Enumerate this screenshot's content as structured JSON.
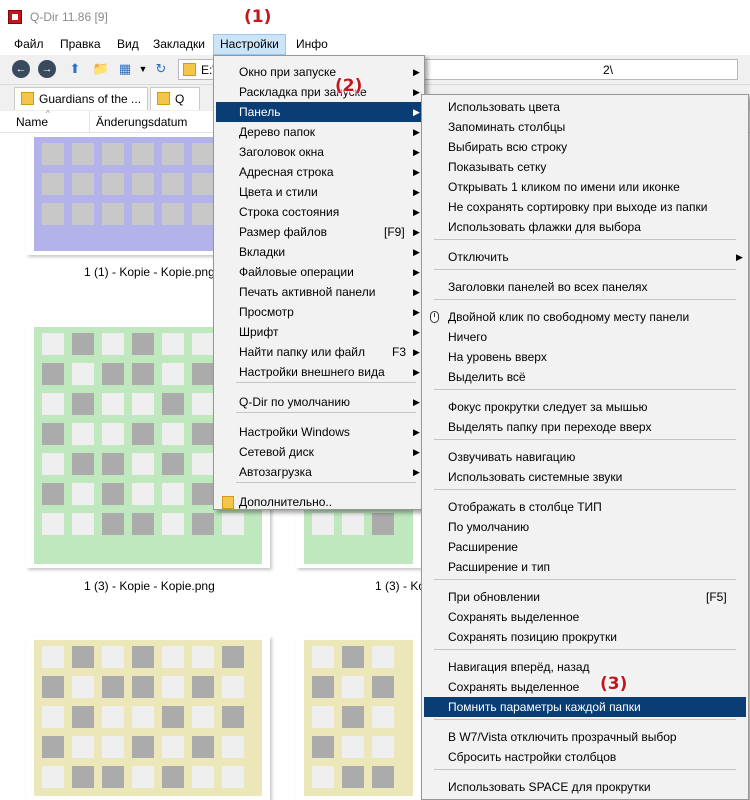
{
  "window": {
    "title": "Q-Dir 11.86 [9]"
  },
  "menubar": {
    "items": [
      {
        "label": "Файл"
      },
      {
        "label": "Правка"
      },
      {
        "label": "Вид"
      },
      {
        "label": "Закладки"
      },
      {
        "label": "Настройки",
        "active": true
      },
      {
        "label": "Инфо"
      }
    ]
  },
  "toolbar": {
    "back_icon": "arrow-left-icon",
    "forward_icon": "arrow-right-icon",
    "path_prefix": "E:\\",
    "path_suffix": "2\\"
  },
  "tabs": [
    {
      "label": "Guardians of the ..."
    },
    {
      "label": "Q"
    }
  ],
  "columns": {
    "name": "Name",
    "date": "Änderungsdatum"
  },
  "files": [
    {
      "name": "1 (1) - Kopie - Kopie.png",
      "color": "#b3b3ea"
    },
    {
      "name": "1 (3) - Kopie - Kopie.png",
      "color": "#bfe8bf"
    },
    {
      "name": "1 (3) - Ko",
      "color": "#bfe8bf"
    },
    {
      "name": "",
      "color": "#ece7b8"
    },
    {
      "name": "",
      "color": "#ece7b8"
    }
  ],
  "settings_menu": {
    "items": [
      {
        "label": "Окно при запуске",
        "submenu": true
      },
      {
        "label": "Раскладка при запуске",
        "submenu": true
      },
      {
        "label": "Панель",
        "submenu": true,
        "highlight": true
      },
      {
        "label": "Дерево папок",
        "submenu": true
      },
      {
        "label": "Заголовок окна",
        "submenu": true
      },
      {
        "label": "Адресная строка",
        "submenu": true
      },
      {
        "label": "Цвета и стили",
        "submenu": true
      },
      {
        "label": "Строка состояния",
        "submenu": true
      },
      {
        "label": "Размер файлов",
        "shortcut": "[F9]",
        "submenu": true
      },
      {
        "label": "Вкладки",
        "submenu": true
      },
      {
        "label": "Файловые операции",
        "submenu": true
      },
      {
        "label": "Печать активной панели",
        "submenu": true
      },
      {
        "label": "Просмотр",
        "submenu": true
      },
      {
        "label": "Шрифт",
        "submenu": true
      },
      {
        "label": "Найти папку или файл",
        "shortcut": "F3",
        "submenu": true
      },
      {
        "label": "Настройки внешнего вида",
        "submenu": true
      },
      {
        "label": "Q-Dir по умолчанию",
        "submenu": true
      },
      {
        "label": "Настройки Windows",
        "submenu": true
      },
      {
        "label": "Сетевой диск",
        "submenu": true
      },
      {
        "label": "Автозагрузка",
        "submenu": true
      },
      {
        "label": "Дополнительно..",
        "submenu": false
      }
    ]
  },
  "panel_menu": {
    "items": [
      {
        "label": "Использовать цвета"
      },
      {
        "label": "Запоминать столбцы"
      },
      {
        "label": "Выбирать всю строку"
      },
      {
        "label": "Показывать сетку"
      },
      {
        "label": "Открывать 1 кликом по имени или иконке"
      },
      {
        "label": "Не сохранять сортировку при выходе из папки"
      },
      {
        "label": "Использовать флажки для выбора"
      },
      {
        "label": "Отключить",
        "submenu": true
      },
      {
        "label": "Заголовки панелей во всех панелях"
      },
      {
        "label": "Двойной клик по свободному месту панели"
      },
      {
        "label": "Ничего"
      },
      {
        "label": "На уровень вверх"
      },
      {
        "label": "Выделить всё"
      },
      {
        "label": "Фокус прокрутки следует за мышью"
      },
      {
        "label": "Выделять папку при переходе вверх"
      },
      {
        "label": "Озвучивать навигацию"
      },
      {
        "label": "Использовать системные звуки"
      },
      {
        "label": "Отображать в столбце ТИП"
      },
      {
        "label": "По умолчанию"
      },
      {
        "label": "Расширение"
      },
      {
        "label": "Расширение и тип"
      },
      {
        "label": "При обновлении",
        "shortcut": "[F5]"
      },
      {
        "label": "Сохранять выделенное"
      },
      {
        "label": "Сохранять позицию прокрутки"
      },
      {
        "label": "Навигация вперёд, назад"
      },
      {
        "label": "Сохранять выделенное"
      },
      {
        "label": "Помнить параметры каждой папки",
        "highlight": true
      },
      {
        "label": "В W7/Vista отключить прозрачный выбор"
      },
      {
        "label": "Сбросить настройки столбцов"
      },
      {
        "label": "Использовать SPACE для прокрутки"
      }
    ]
  },
  "annotations": [
    "(1)",
    "(2)",
    "(3)"
  ],
  "colors": {
    "highlight": "#0b3d75",
    "menu_bg": "#f2f2f2",
    "annotation": "#c4161c",
    "active_menu": "#cce4f7"
  }
}
